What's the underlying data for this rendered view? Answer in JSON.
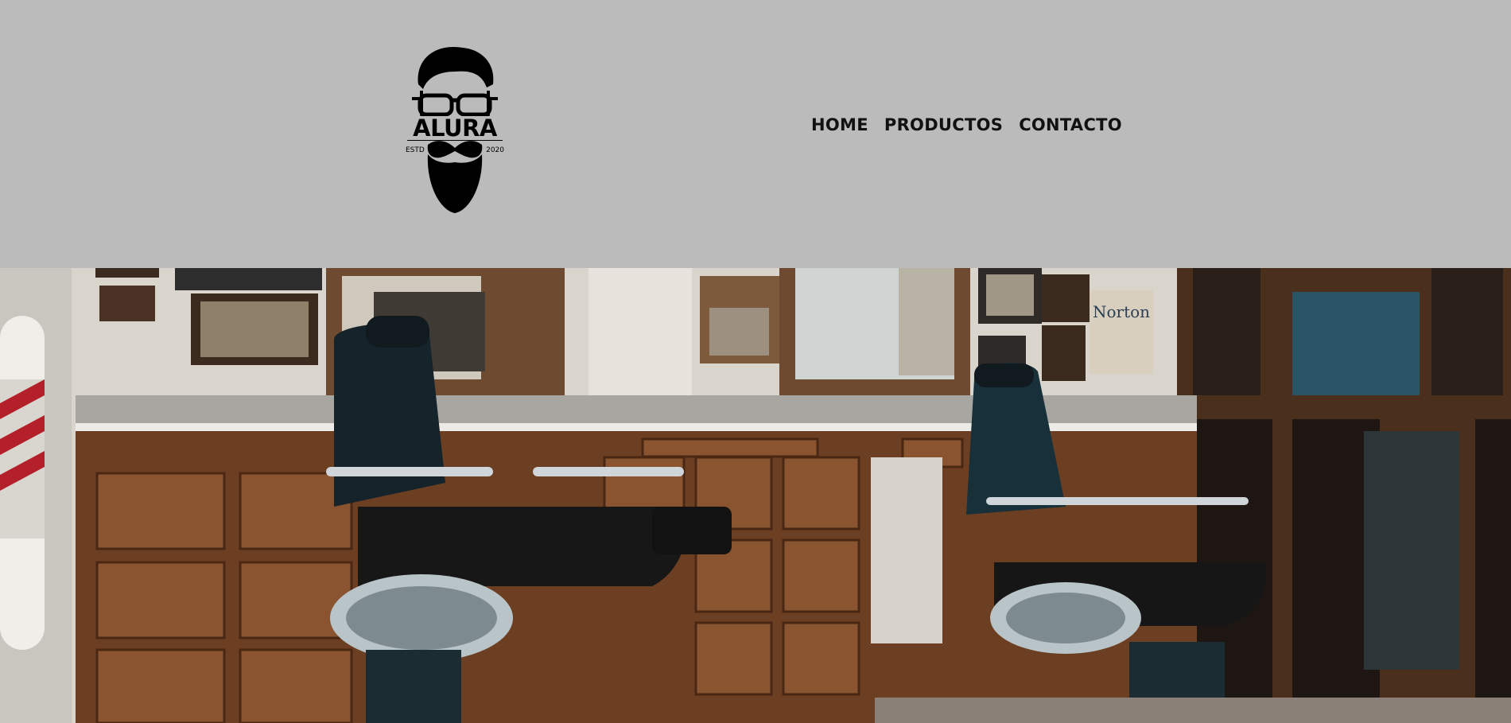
{
  "logo": {
    "brand": "ALURA",
    "estd_label": "ESTD",
    "year": "2020",
    "icon": "bearded-man-glasses-icon"
  },
  "nav": {
    "items": [
      {
        "label": "HOME"
      },
      {
        "label": "PRODUCTOS"
      },
      {
        "label": "CONTACTO"
      }
    ]
  },
  "hero": {
    "sign_text": "Norton"
  },
  "colors": {
    "header_bg": "#bbbbbb",
    "wood": "#7a4a2c",
    "chair_leather": "#1b2a2f"
  }
}
